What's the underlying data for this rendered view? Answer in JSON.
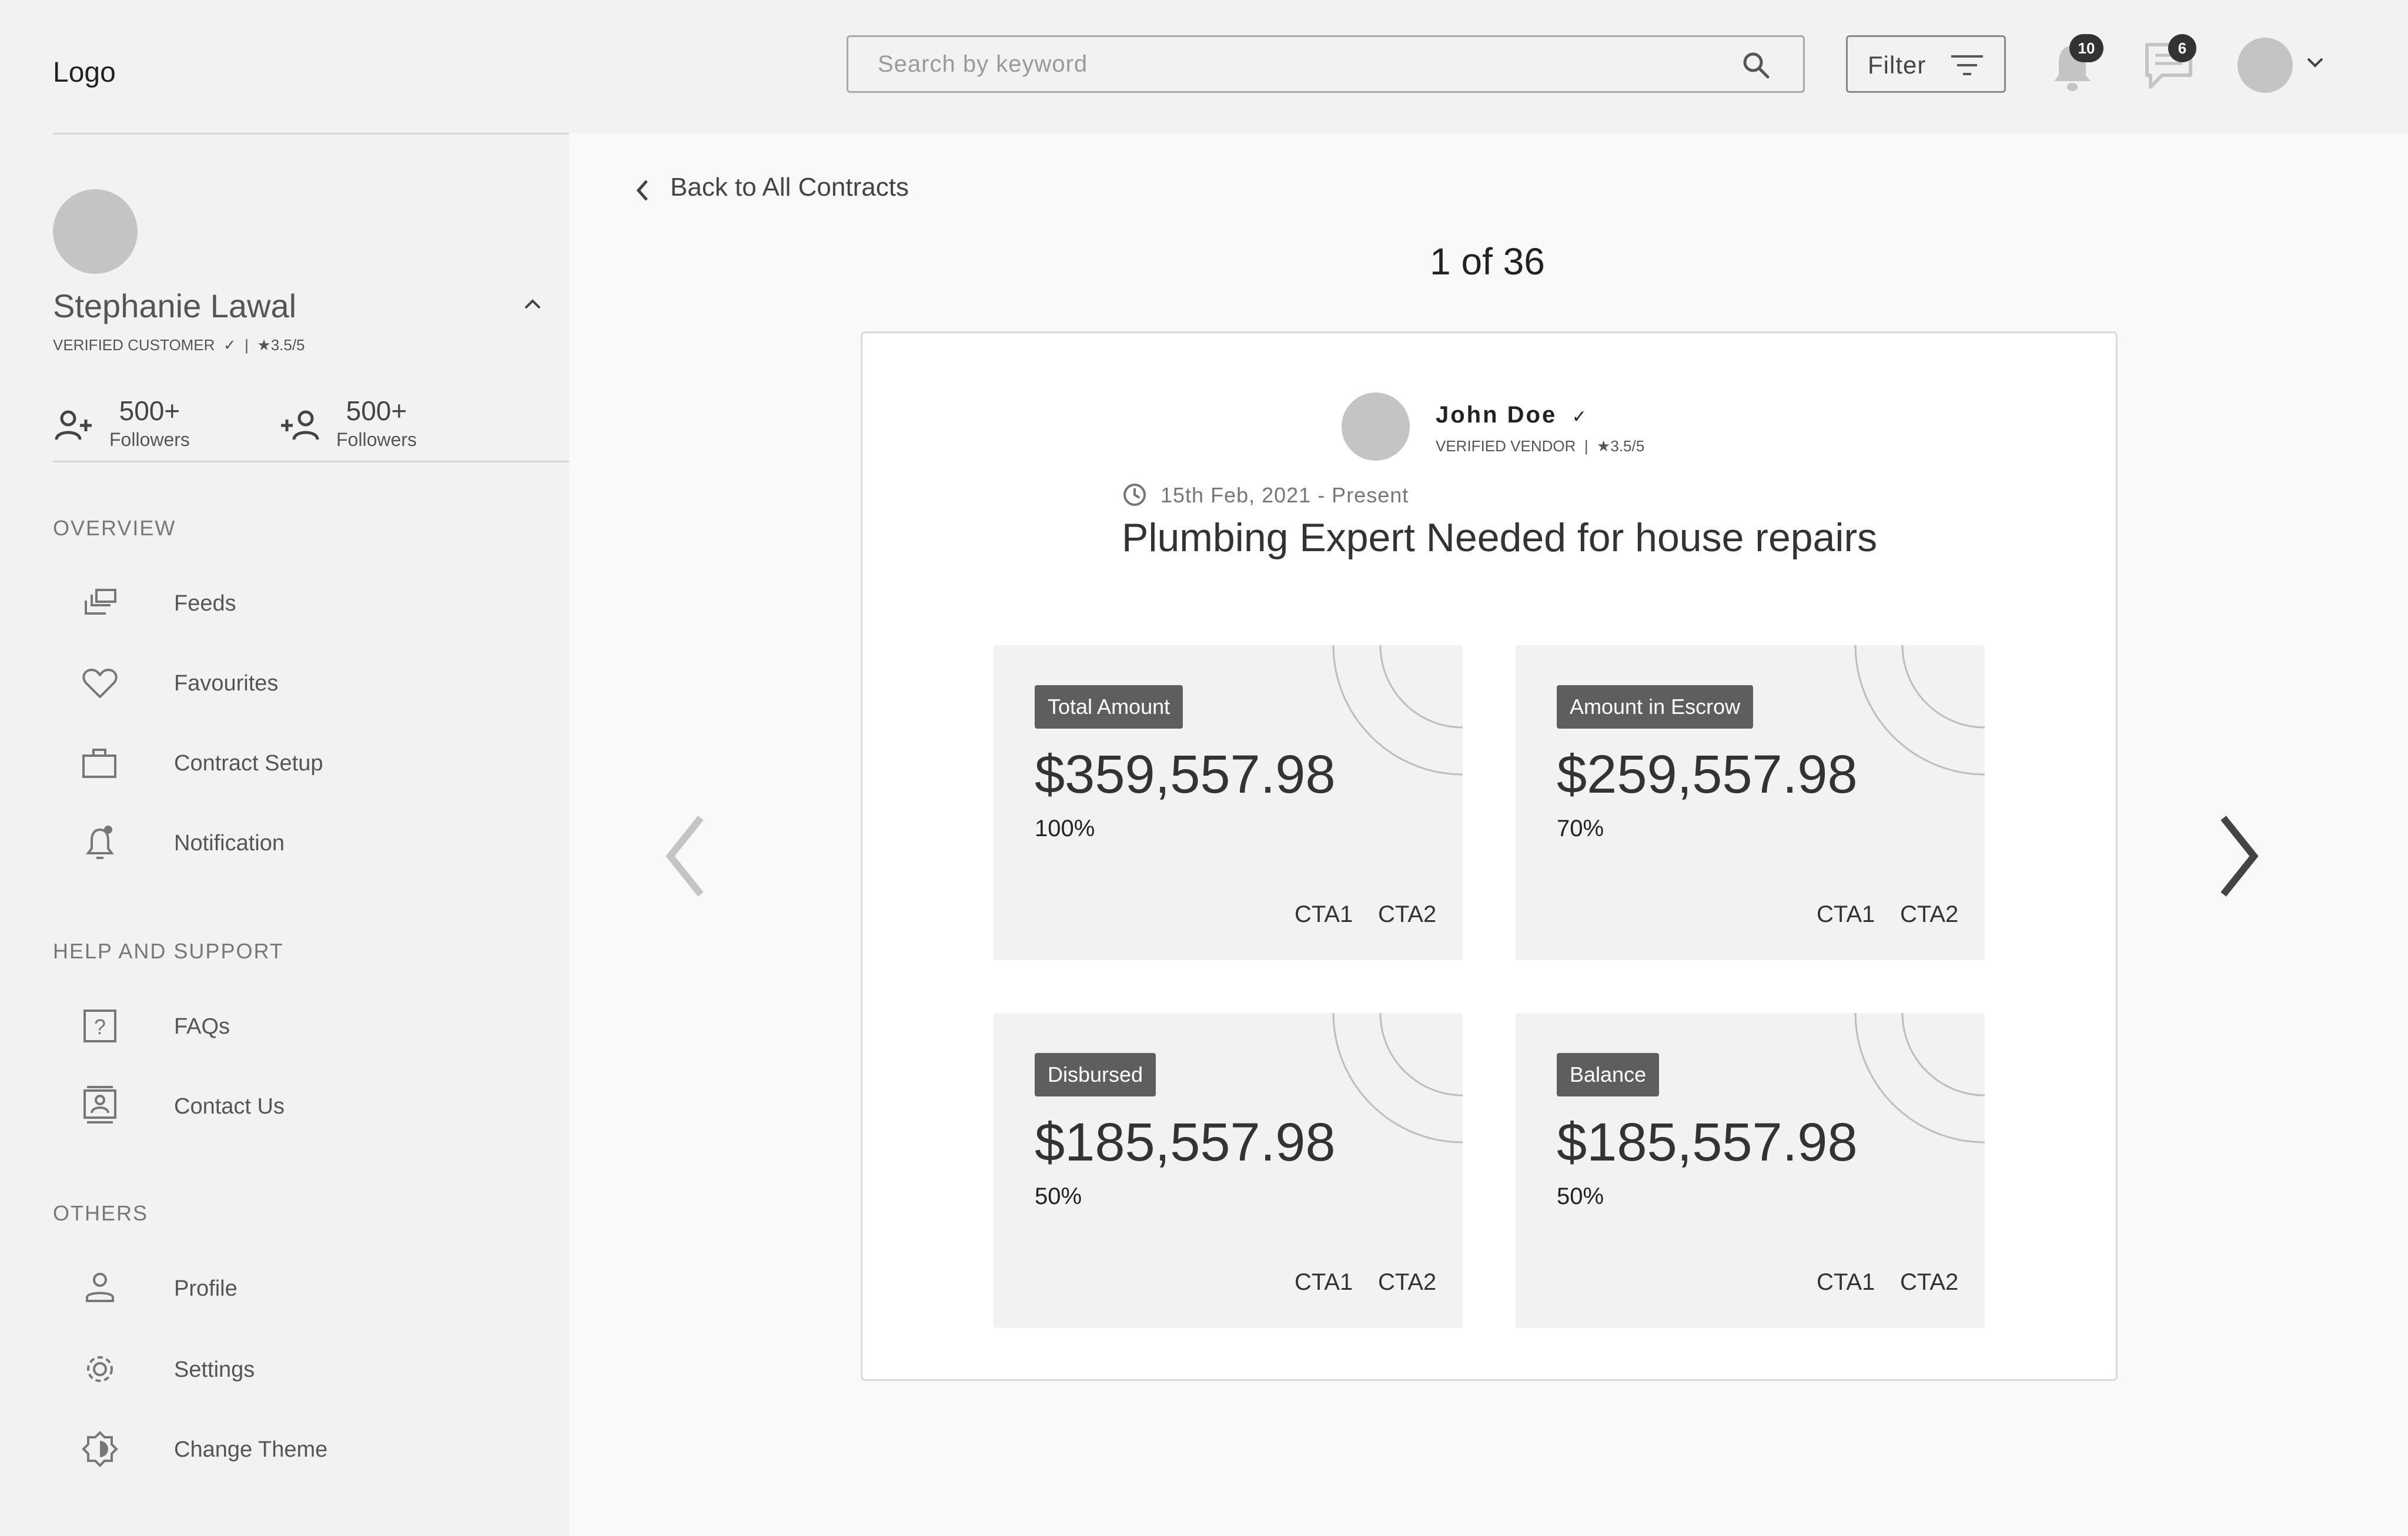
{
  "header": {
    "logo": "Logo",
    "search_placeholder": "Search by keyword",
    "filter_label": "Filter",
    "notifications_count": "10",
    "messages_count": "6"
  },
  "profile": {
    "name": "Stephanie Lawal",
    "status": "VERIFIED CUSTOMER",
    "rating": "3.5/5",
    "stats": [
      {
        "value": "500+",
        "label": "Followers"
      },
      {
        "value": "500+",
        "label": "Followers"
      }
    ]
  },
  "sidebar": {
    "sections": [
      {
        "title": "OVERVIEW",
        "items": [
          {
            "label": "Feeds",
            "icon": "feeds-icon"
          },
          {
            "label": "Favourites",
            "icon": "heart-icon"
          },
          {
            "label": "Contract Setup",
            "icon": "briefcase-icon"
          },
          {
            "label": "Notification",
            "icon": "bell-icon"
          }
        ]
      },
      {
        "title": "HELP AND SUPPORT",
        "items": [
          {
            "label": "FAQs",
            "icon": "question-icon"
          },
          {
            "label": "Contact Us",
            "icon": "contact-card-icon"
          }
        ]
      },
      {
        "title": "OTHERS",
        "items": [
          {
            "label": "Profile",
            "icon": "user-icon"
          },
          {
            "label": "Settings",
            "icon": "gear-icon"
          },
          {
            "label": "Change Theme",
            "icon": "theme-icon"
          }
        ]
      }
    ]
  },
  "main": {
    "back_label": "Back to All Contracts",
    "pager": "1 of 36",
    "vendor": {
      "name": "John Doe",
      "status": "VERIFIED VENDOR",
      "rating": "3.5/5"
    },
    "date_range": "15th Feb, 2021 - Present",
    "title": "Plumbing Expert Needed for house repairs",
    "tiles": [
      {
        "label": "Total Amount",
        "amount": "$359,557.98",
        "percent": "100%",
        "cta1": "CTA1",
        "cta2": "CTA2"
      },
      {
        "label": "Amount in Escrow",
        "amount": "$259,557.98",
        "percent": "70%",
        "cta1": "CTA1",
        "cta2": "CTA2"
      },
      {
        "label": "Disbursed",
        "amount": "$185,557.98",
        "percent": "50%",
        "cta1": "CTA1",
        "cta2": "CTA2"
      },
      {
        "label": "Balance",
        "amount": "$185,557.98",
        "percent": "50%",
        "cta1": "CTA1",
        "cta2": "CTA2"
      }
    ]
  }
}
